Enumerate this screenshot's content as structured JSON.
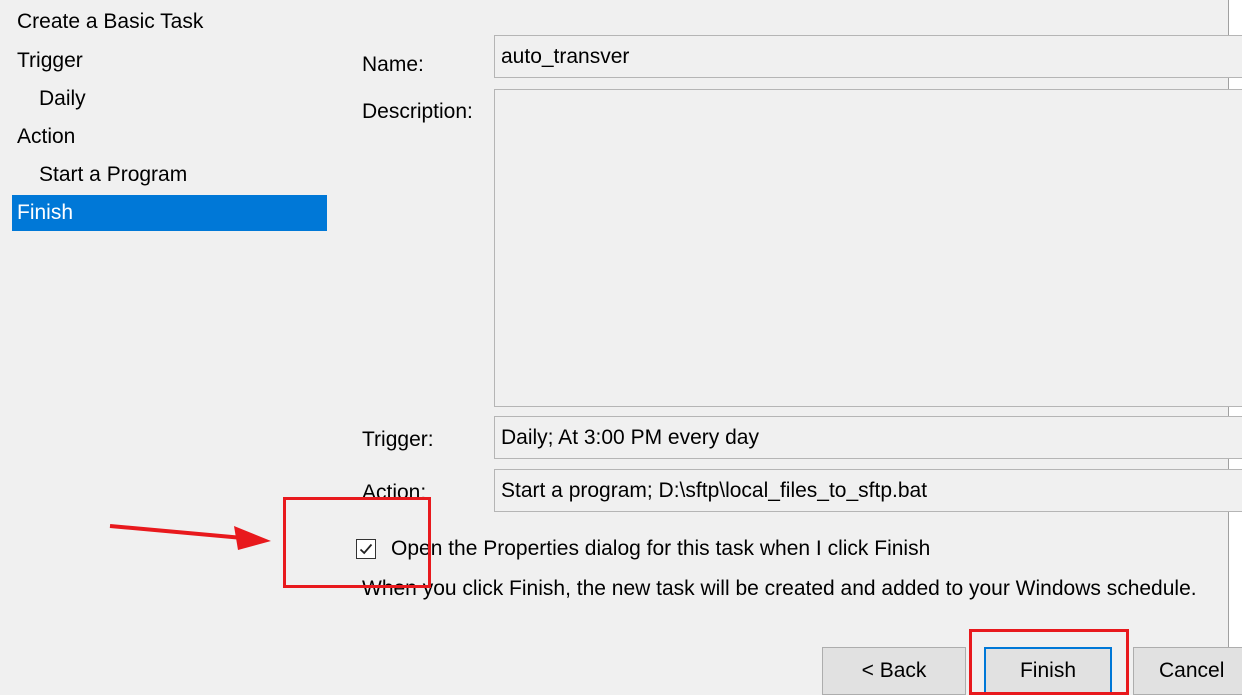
{
  "wizard": {
    "title": "Create a Basic Task"
  },
  "nav": {
    "items": [
      {
        "label": "Trigger"
      },
      {
        "label": "Daily"
      },
      {
        "label": "Action"
      },
      {
        "label": "Start a Program"
      },
      {
        "label": "Finish"
      }
    ]
  },
  "form": {
    "name_label": "Name:",
    "name_value": "auto_transver",
    "description_label": "Description:",
    "description_value": "",
    "trigger_label": "Trigger:",
    "trigger_value": "Daily; At 3:00 PM every day",
    "action_label": "Action:",
    "action_value": "Start a program; D:\\sftp\\local_files_to_sftp.bat"
  },
  "options": {
    "open_properties_label": "Open the Properties dialog for this task when I click Finish",
    "open_properties_checked": true
  },
  "info": {
    "text": "When you click Finish, the new task will be created and added to your Windows schedule."
  },
  "buttons": {
    "back_label": "< Back",
    "finish_label": "Finish",
    "cancel_label": "Cancel"
  },
  "colors": {
    "selection": "#0078d7",
    "annotation": "#e8191d",
    "window_bg": "#f0f0f0"
  }
}
